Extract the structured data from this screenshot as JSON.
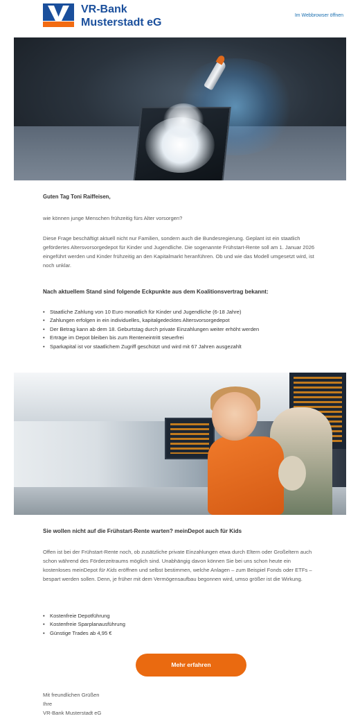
{
  "header": {
    "brand_line1": "VR-Bank",
    "brand_line2": "Musterstadt eG",
    "webview_link": "Im Webbrowser öffnen",
    "brand_color": "#1a4f9c",
    "accent_color": "#f26b12"
  },
  "intro": {
    "greeting": "Guten Tag Toni Raiffeisen,",
    "question": "wie können junge Menschen frühzeitig fürs Alter vorsorgen?",
    "paragraph": "Diese Frage beschäftigt aktuell nicht nur Familien, sondern auch die Bundesregierung. Geplant ist ein staatlich gefördertes Altersvorsorgedepot für Kinder und Jugendliche. Die sogenannte Frühstart-Rente soll am 1. Januar 2026 eingeführt werden und Kinder frühzeitig an den Kapitalmarkt heranführen. Ob und wie das Modell umgesetzt wird, ist noch unklar."
  },
  "section1": {
    "heading": "Nach aktuellem Stand sind folgende Eckpunkte aus dem Koalitionsvertrag bekannt:",
    "bullets": [
      "Staatliche Zahlung von 10 Euro monatlich für Kinder und Jugendliche (6-18 Jahre)",
      "Zahlungen erfolgen in ein individuelles, kapitalgedecktes Altersvorsorgedepot",
      "Der Betrag kann ab dem 18. Geburtstag durch private Einzahlungen weiter erhöht werden",
      "Erträge im Depot bleiben bis zum Renteneintritt steuerfrei",
      "Sparkapital ist vor staatlichem Zugriff geschützt und wird mit 67 Jahren ausgezahlt"
    ]
  },
  "section2": {
    "heading": "Sie wollen nicht auf die Frühstart-Rente warten? meinDepot auch für Kids",
    "paragraph_before_em": "Offen ist bei der Frühstart-Rente noch, ob zusätzliche private Einzahlungen etwa durch Eltern oder Großeltern auch schon während des Förderzeitraums möglich sind. Unabhängig davon können Sie bei uns schon heute ein kostenloses meinDepot ",
    "paragraph_em": "für Kids",
    "paragraph_after_em": " eröffnen und selbst bestimmen, welche Anlagen – zum Beispiel Fonds oder ETFs – bespart werden sollen. Denn, je früher mit dem Vermögensaufbau begonnen wird, umso größer ist die Wirkung.",
    "bullets": [
      "Kostenfreie Depotführung",
      "Kostenfreie Sparplanausführung",
      "Günstige Trades ab 4,95 €"
    ]
  },
  "cta": {
    "label": "Mehr erfahren",
    "color": "#ea6a10"
  },
  "closing": {
    "line1": "Mit freundlichen Grüßen",
    "line2": "Ihre",
    "line3": "VR-Bank Musterstadt eG"
  }
}
